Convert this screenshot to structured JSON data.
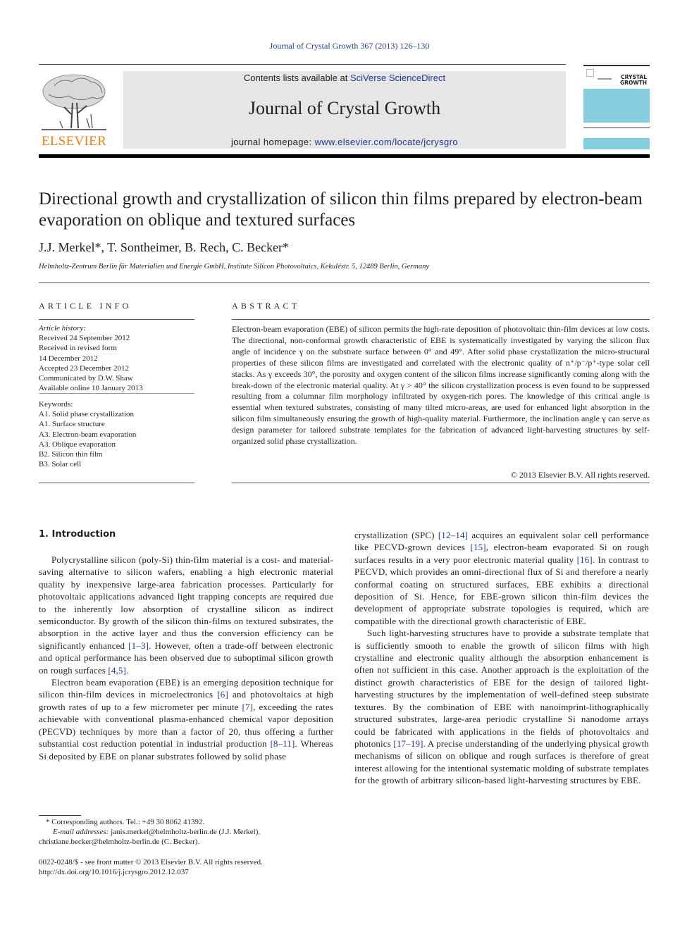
{
  "running_head": "Journal of Crystal Growth 367 (2013) 126–130",
  "header": {
    "publisher_logo_text": "ELSEVIER",
    "contents_prefix": "Contents lists available at ",
    "contents_link": "SciVerse ScienceDirect",
    "journal_name": "Journal of Crystal Growth",
    "homepage_prefix": "journal homepage: ",
    "homepage_link": "www.elsevier.com/locate/jcrysgro",
    "cover_title_line1": "CRYSTAL",
    "cover_title_line2": "GROWTH",
    "colors": {
      "elsevier_orange": "#f07f1a",
      "link_blue": "#1f3a93",
      "cover_blue": "#87cde0",
      "header_grey": "#e6e6e6"
    }
  },
  "article": {
    "title": "Directional growth and crystallization of silicon thin films prepared by electron-beam evaporation on oblique and textured surfaces",
    "authors": "J.J. Merkel*, T. Sontheimer, B. Rech, C. Becker*",
    "affiliation": "Helmholtz-Zentrum Berlin für Materialien und Energie GmbH, Institute Silicon Photovoltaics, Kekuléstr. 5, 12489 Berlin, Germany"
  },
  "article_info": {
    "heading": "ARTICLE INFO",
    "history_label": "Article history:",
    "history": [
      "Received 24 September 2012",
      "Received in revised form",
      "14 December 2012",
      "Accepted 23 December 2012",
      "Communicated by D.W. Shaw",
      "Available online 10 January 2013"
    ],
    "keywords_label": "Keywords:",
    "keywords": [
      "A1. Solid phase crystallization",
      "A1. Surface structure",
      "A3. Electron-beam evaporation",
      "A3. Oblique evaporation",
      "B2. Silicon thin film",
      "B3. Solar cell"
    ]
  },
  "abstract": {
    "heading": "ABSTRACT",
    "text": "Electron-beam evaporation (EBE) of silicon permits the high-rate deposition of photovoltaic thin-film devices at low costs. The directional, non-conformal growth characteristic of EBE is systematically investigated by varying the silicon flux angle of incidence γ on the substrate surface between 0° and 49°. After solid phase crystallization the micro-structural properties of these silicon films are investigated and correlated with the electronic quality of n⁺/p⁻/p⁺-type solar cell stacks. As γ exceeds 30°, the porosity and oxygen content of the silicon films increase significantly coming along with the break-down of the electronic material quality. At γ > 40° the silicon crystallization process is even found to be suppressed resulting from a columnar film morphology infiltrated by oxygen-rich pores. The knowledge of this critical angle is essential when textured substrates, consisting of many tilted micro-areas, are used for enhanced light absorption in the silicon film simultaneously ensuring the growth of high-quality material. Furthermore, the inclination angle γ can serve as design parameter for tailored substrate templates for the fabrication of advanced light-harvesting structures by self-organized solid phase crystallization.",
    "copyright": "© 2013 Elsevier B.V. All rights reserved."
  },
  "introduction": {
    "heading": "1.  Introduction",
    "left_p1": [
      "Polycrystalline silicon (poly-Si) thin-film material is a cost- and material-saving alternative to silicon wafers, enabling a high electronic material quality by inexpensive large-area fabrication processes. Particularly for photovoltaic applications advanced light trapping concepts are required due to the inherently low absorption of crystalline silicon as indirect semiconductor. By growth of the silicon thin-films on textured substrates, the absorption in the active layer and thus the conversion efficiency can be significantly enhanced ",
      "[1–3]",
      ". However, often a trade-off between electronic and optical performance has been observed due to suboptimal silicon growth on rough surfaces ",
      "[4,5]",
      "."
    ],
    "left_p2": [
      "Electron beam evaporation (EBE) is an emerging deposition technique for silicon thin-film devices in microelectronics ",
      "[6]",
      " and photovoltaics at high growth rates of up to a few micrometer per minute ",
      "[7]",
      ", exceeding the rates achievable with conventional plasma-enhanced chemical vapor deposition (PECVD) techniques by more than a factor of 20, thus offering a further substantial cost reduction potential in industrial production ",
      "[8–11]",
      ". Whereas Si deposited by EBE on planar substrates followed by solid phase"
    ],
    "right_p1": [
      "crystallization (SPC) ",
      "[12–14]",
      " acquires an equivalent solar cell performance like PECVD-grown devices ",
      "[15]",
      ", electron-beam evaporated Si on rough surfaces results in a very poor electronic material quality ",
      "[16]",
      ". In contrast to PECVD, which provides an omni-directional flux of Si and therefore a nearly conformal coating on structured surfaces, EBE exhibits a directional deposition of Si. Hence, for EBE-grown silicon thin-film devices the development of appropriate substrate topologies is required, which are compatible with the directional growth characteristic of EBE."
    ],
    "right_p2": [
      "Such light-harvesting structures have to provide a substrate template that is sufficiently smooth to enable the growth of silicon films with high crystalline and electronic quality although the absorption enhancement is often not sufficient in this case. Another approach is the exploitation of the distinct growth characteristics of EBE for the design of tailored light-harvesting structures by the implementation of well-defined steep substrate textures. By the combination of EBE with nanoimprint-lithographically structured substrates, large-area periodic crystalline Si nanodome arrays could be fabricated with applications in the fields of photovoltaics and photonics ",
      "[17–19]",
      ". A precise understanding of the underlying physical growth mechanisms of silicon on oblique and rough surfaces is therefore of great interest allowing for the intentional systematic molding of substrate templates for the growth of arbitrary silicon-based light-harvesting structures by EBE."
    ]
  },
  "footnote": {
    "corresponding": "* Corresponding authors. Tel.: +49 30 8062 41392.",
    "email_label": "E-mail addresses:",
    "email_1": " janis.merkel@helmholtz-berlin.de (J.J. Merkel),",
    "email_2": "christiane.becker@helmholtz-berlin.de (C. Becker).",
    "front_matter": "0022-0248/$ - see front matter © 2013 Elsevier B.V. All rights reserved.",
    "doi": "http://dx.doi.org/10.1016/j.jcrysgro.2012.12.037"
  }
}
